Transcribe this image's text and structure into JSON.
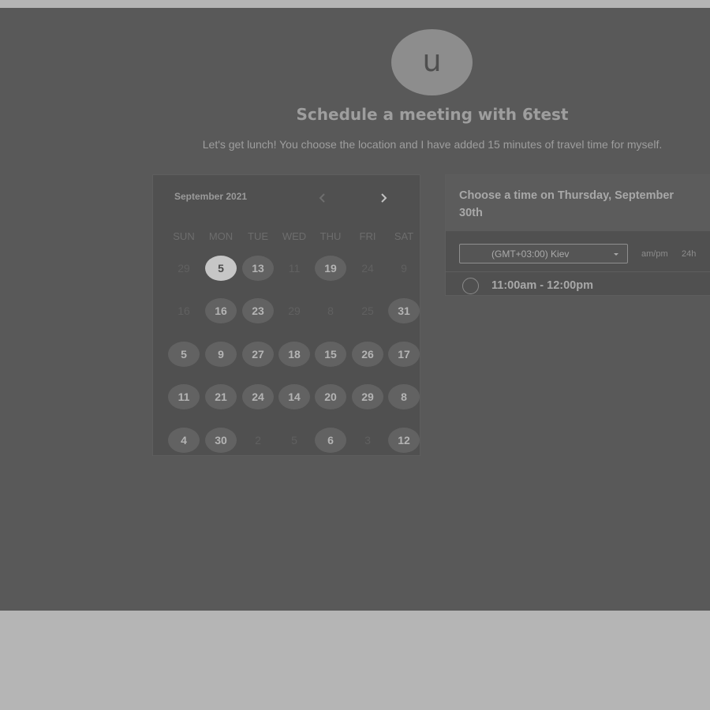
{
  "avatar": {
    "initial": "u"
  },
  "header": {
    "title": "Schedule a meeting with 6test",
    "subtitle": "Let's get lunch! You choose the location and I have added 15 minutes of travel time for myself."
  },
  "calendar": {
    "month_label": "September 2021",
    "weekdays": [
      "SUN",
      "MON",
      "TUE",
      "WED",
      "THU",
      "FRI",
      "SAT"
    ],
    "weeks": [
      [
        {
          "label": "29",
          "state": "unavailable"
        },
        {
          "label": "5",
          "state": "selected"
        },
        {
          "label": "13",
          "state": "available"
        },
        {
          "label": "11",
          "state": "unavailable"
        },
        {
          "label": "19",
          "state": "available"
        },
        {
          "label": "24",
          "state": "unavailable"
        },
        {
          "label": "9",
          "state": "unavailable"
        }
      ],
      [
        {
          "label": "16",
          "state": "unavailable"
        },
        {
          "label": "16",
          "state": "available"
        },
        {
          "label": "23",
          "state": "available"
        },
        {
          "label": "29",
          "state": "unavailable"
        },
        {
          "label": "8",
          "state": "unavailable"
        },
        {
          "label": "25",
          "state": "unavailable"
        },
        {
          "label": "31",
          "state": "available"
        }
      ],
      [
        {
          "label": "5",
          "state": "available"
        },
        {
          "label": "9",
          "state": "available"
        },
        {
          "label": "27",
          "state": "available"
        },
        {
          "label": "18",
          "state": "available"
        },
        {
          "label": "15",
          "state": "available"
        },
        {
          "label": "26",
          "state": "available"
        },
        {
          "label": "17",
          "state": "available"
        }
      ],
      [
        {
          "label": "11",
          "state": "available"
        },
        {
          "label": "21",
          "state": "available"
        },
        {
          "label": "24",
          "state": "available"
        },
        {
          "label": "14",
          "state": "available"
        },
        {
          "label": "20",
          "state": "available"
        },
        {
          "label": "29",
          "state": "available"
        },
        {
          "label": "8",
          "state": "available"
        }
      ],
      [
        {
          "label": "4",
          "state": "available"
        },
        {
          "label": "30",
          "state": "available"
        },
        {
          "label": "2",
          "state": "unavailable"
        },
        {
          "label": "5",
          "state": "unavailable"
        },
        {
          "label": "6",
          "state": "available"
        },
        {
          "label": "3",
          "state": "unavailable"
        },
        {
          "label": "12",
          "state": "available"
        }
      ]
    ]
  },
  "times": {
    "title": "Choose a time on Thursday, September 30th",
    "timezone": "(GMT+03:00) Kiev",
    "format_ampm": "am/pm",
    "format_24h": "24h",
    "slots": [
      {
        "label": "11:00am - 12:00pm"
      }
    ]
  },
  "icons": {
    "prev": "chevron-left-icon",
    "next": "chevron-right-icon",
    "dropdown": "caret-down-icon",
    "slot": "radio-circle-icon"
  }
}
